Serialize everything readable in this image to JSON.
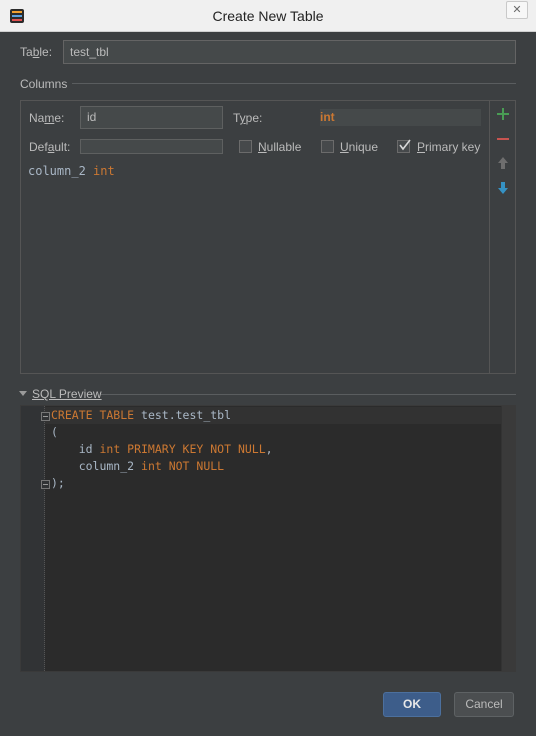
{
  "window": {
    "title": "Create New Table",
    "close_glyph": "✕"
  },
  "table": {
    "label": "Table:",
    "value": "test_tbl"
  },
  "columns_section": {
    "title": "Columns"
  },
  "column_editor": {
    "name_label": "Name:",
    "name_value": "id",
    "type_label": "Type:",
    "type_value": "int",
    "default_label": "Default:",
    "default_value": "",
    "nullable_label": "Nullable",
    "nullable_checked": false,
    "unique_label": "Unique",
    "unique_checked": false,
    "primary_key_label": "Primary key",
    "primary_key_checked": true
  },
  "columns_list": [
    {
      "name": "column_2",
      "type": "int"
    }
  ],
  "toolbar": {
    "add_icon": "plus-icon",
    "remove_icon": "minus-icon",
    "move_up_icon": "arrow-up-icon",
    "move_down_icon": "arrow-down-icon",
    "add_color": "#499c54",
    "remove_color": "#c75450",
    "move_down_color": "#3592c4"
  },
  "sql_preview": {
    "title": "SQL Preview",
    "lines": [
      {
        "kw": "CREATE TABLE",
        "rest": " test.test_tbl"
      },
      {
        "kw": "",
        "rest": "("
      },
      {
        "ident": "    id",
        "kw": " int PRIMARY KEY NOT NULL",
        "rest": ","
      },
      {
        "ident": "    column_2",
        "kw": " int NOT NULL",
        "rest": ""
      },
      {
        "kw": "",
        "rest": ");"
      }
    ]
  },
  "buttons": {
    "ok": "OK",
    "cancel": "Cancel"
  },
  "colors": {
    "keyword": "#cc7832",
    "background": "#3c3f41",
    "editor_bg": "#2b2b2b"
  }
}
